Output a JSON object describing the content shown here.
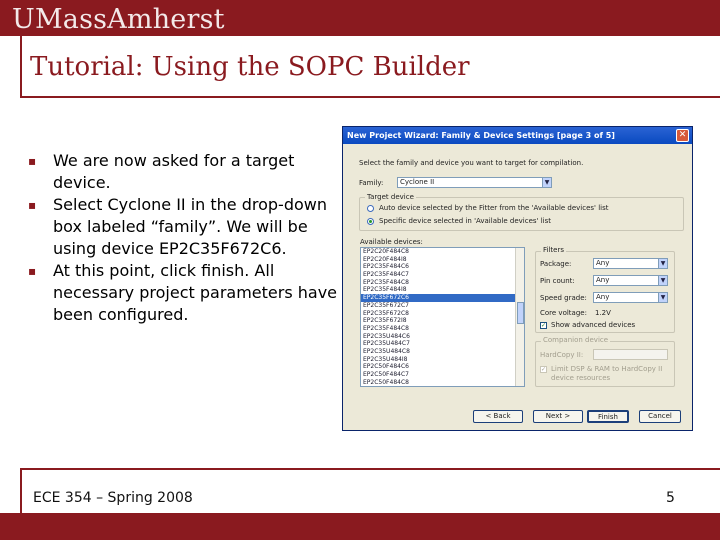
{
  "header": {
    "brand": "UMassAmherst",
    "title": "Tutorial:  Using the SOPC Builder"
  },
  "bullets": [
    "We are now asked for a target device.",
    "Select Cyclone II in the drop-down box labeled “family”. We will be using device EP2C35F672C6.",
    "At this point, click finish.  All necessary project parameters have been configured."
  ],
  "bullet_marker": "▪",
  "footer": {
    "left": "ECE 354 – Spring 2008",
    "right": "5"
  },
  "dialog": {
    "title": "New Project Wizard: Family & Device Settings [page 3 of 5]",
    "close_glyph": "✕",
    "instruction": "Select the family and device you want to target for compilation.",
    "family_label": "Family:",
    "family_value": "Cyclone II",
    "target_device_label": "Target device",
    "radio_auto": "Auto device selected by the Fitter from the 'Available devices' list",
    "radio_specific": "Specific device selected in 'Available devices' list",
    "available_label": "Available devices:",
    "filters_label": "Filters",
    "package_label": "Package:",
    "package_value": "Any",
    "pincount_label": "Pin count:",
    "pincount_value": "Any",
    "speedgrade_label": "Speed grade:",
    "speedgrade_value": "Any",
    "corevoltage_label": "Core voltage:",
    "corevoltage_value": "1.2V",
    "show_advanced_label": "Show advanced devices",
    "companion_label": "Companion device",
    "hardcopy_label": "HardCopy II:",
    "limit_label_1": "Limit DSP & RAM to HardCopy II",
    "limit_label_2": "device resources",
    "back_button": "< Back",
    "next_button": "Next >",
    "finish_button": "Finish",
    "cancel_button": "Cancel",
    "check_glyph": "✓",
    "dropdown_glyph": "▼",
    "devices": [
      "EP2C20F484C8",
      "EP2C20F484I8",
      "EP2C35F484C6",
      "EP2C35F484C7",
      "EP2C35F484C8",
      "EP2C35F484I8",
      "EP2C35F672C6",
      "EP2C35F672C7",
      "EP2C35F672C8",
      "EP2C35F672I8",
      "EP2C35F484C8",
      "EP2C35U484C6",
      "EP2C35U484C7",
      "EP2C35U484C8",
      "EP2C35U484I8",
      "EP2C50F484C6",
      "EP2C50F484C7",
      "EP2C50F484C8"
    ],
    "selected_device": "EP2C35F672C6"
  }
}
